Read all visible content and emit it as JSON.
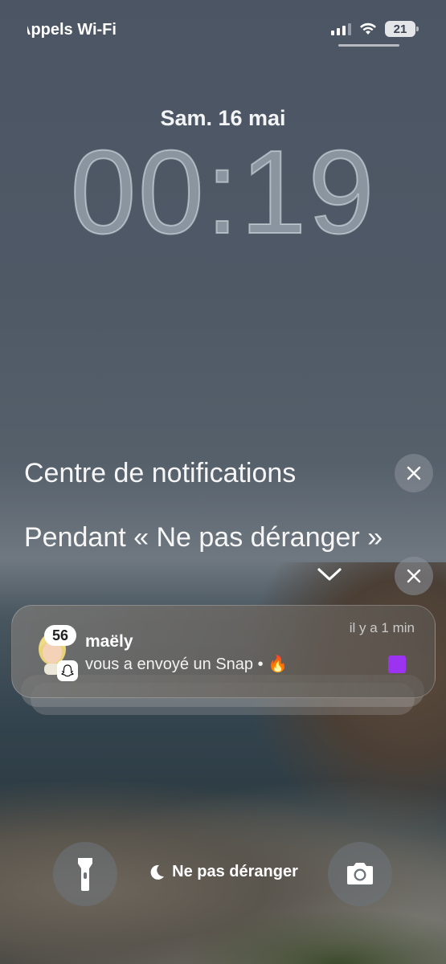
{
  "status": {
    "carrier": "Appels Wi-Fi",
    "battery": "21"
  },
  "lock": {
    "date": "Sam. 16 mai",
    "time": "00:19"
  },
  "sections": {
    "notification_center": "Centre de notifications",
    "dnd_section": "Pendant « Ne pas déranger »"
  },
  "notification": {
    "badge": "56",
    "sender": "maëly",
    "time": "il y a 1 min",
    "body": "vous a envoyé un Snap •",
    "emoji": "🔥",
    "accent_color": "#9b33f0"
  },
  "bottom": {
    "focus_label": "Ne pas déranger"
  },
  "icons": [
    "signal-icon",
    "wifi-icon",
    "battery-icon",
    "close-icon",
    "chevron-down-icon",
    "avatar",
    "snapchat-ghost-icon",
    "flashlight-icon",
    "moon-icon",
    "camera-icon"
  ]
}
